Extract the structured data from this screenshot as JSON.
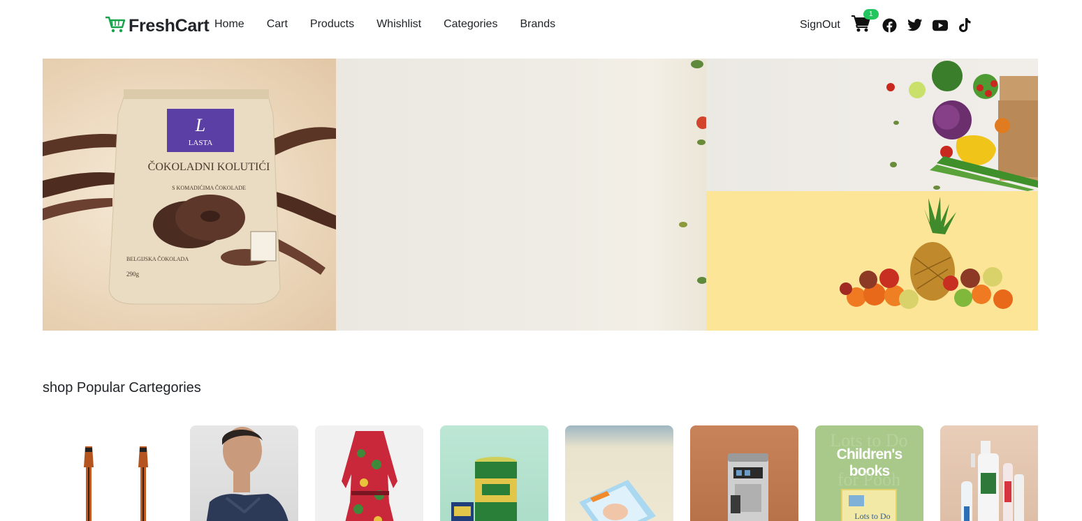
{
  "brand": {
    "name": "FreshCart",
    "icon": "cart-icon",
    "color": "#16a34a"
  },
  "nav": {
    "links": [
      {
        "label": "Home"
      },
      {
        "label": "Cart"
      },
      {
        "label": "Products"
      },
      {
        "label": "Whishlist"
      },
      {
        "label": "Categories"
      },
      {
        "label": "Brands"
      }
    ],
    "signout_label": "SignOut",
    "cart_count": "1",
    "social_icons": [
      "facebook-icon",
      "twitter-icon",
      "youtube-icon",
      "tiktok-icon"
    ]
  },
  "hero": {
    "main_slide_product": "ČOKOLADNI KOLUTIĆI",
    "package_logo": "LASTA",
    "package_subtitle": "S KOMADIĆIMA ČOKOLADE",
    "package_weight": "290g",
    "package_origin": "BELGIJSKA ČOKOLADA"
  },
  "categories": {
    "title": "shop Popular Cartegories",
    "items": [
      {
        "image": "music-category-image",
        "text": ""
      },
      {
        "image": "mens-fashion-category-image",
        "text": ""
      },
      {
        "image": "womens-fashion-category-image",
        "text": ""
      },
      {
        "image": "supermarket-category-image",
        "text": ""
      },
      {
        "image": "baby-toys-category-image",
        "text": ""
      },
      {
        "image": "home-appliances-category-image",
        "text": ""
      },
      {
        "image": "books-category-image",
        "text": "Children's books"
      },
      {
        "image": "beauty-health-category-image",
        "text": ""
      }
    ]
  },
  "colors": {
    "accent": "#22c55e",
    "text": "#212529"
  }
}
